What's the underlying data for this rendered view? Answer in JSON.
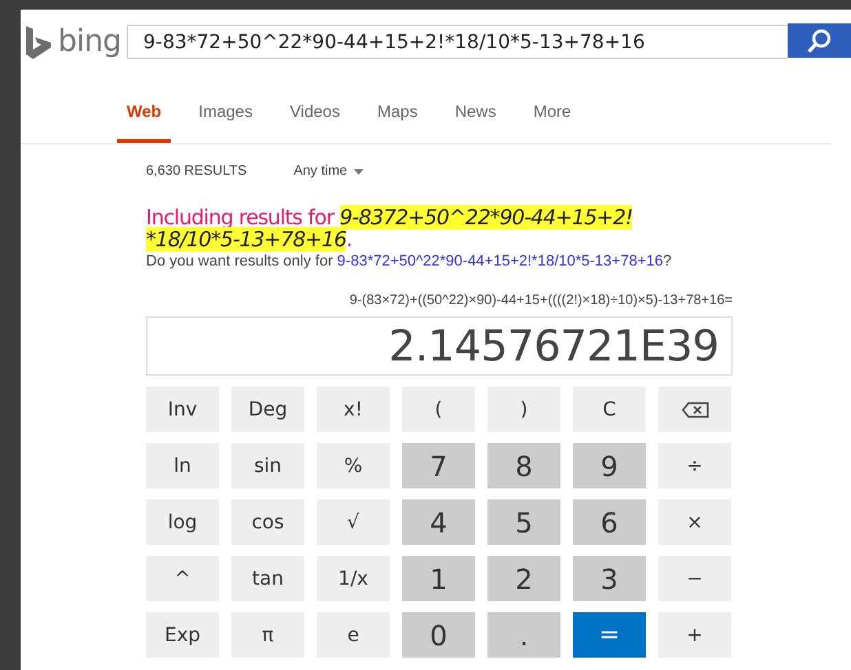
{
  "logo": {
    "text": "bing"
  },
  "search": {
    "value": "9-83*72+50^22*90-44+15+2!*18/10*5-13+78+16"
  },
  "tabs": [
    {
      "label": "Web",
      "selected": true
    },
    {
      "label": "Images",
      "selected": false
    },
    {
      "label": "Videos",
      "selected": false
    },
    {
      "label": "Maps",
      "selected": false
    },
    {
      "label": "News",
      "selected": false
    },
    {
      "label": "More",
      "selected": false
    }
  ],
  "results": {
    "count": "6,630 RESULTS",
    "time_filter": "Any time"
  },
  "spelling": {
    "prefix": "Including results for ",
    "query": "9-8372+50^22*90-44+15+2!*18/10*5-13+78+16",
    "suffix": ".",
    "question_prefix": "Do you want results only for ",
    "original_query": "9-83*72+50^22*90-44+15+2!*18/10*5-13+78+16",
    "question_suffix": "?"
  },
  "calculator": {
    "expression": "9-(83×72)+((50^22)×90)-44+15+((((2!)×18)÷10)×5)-13+78+16=",
    "display": "2.14576721E39",
    "keys": [
      {
        "label": "Inv",
        "kind": "function"
      },
      {
        "label": "Deg",
        "kind": "function"
      },
      {
        "label": "x!",
        "kind": "function"
      },
      {
        "label": "(",
        "kind": "function"
      },
      {
        "label": ")",
        "kind": "function"
      },
      {
        "label": "C",
        "kind": "function"
      },
      {
        "kind": "backspace"
      },
      {
        "label": "ln",
        "kind": "function"
      },
      {
        "label": "sin",
        "kind": "function"
      },
      {
        "label": "%",
        "kind": "function"
      },
      {
        "label": "7",
        "kind": "digit"
      },
      {
        "label": "8",
        "kind": "digit"
      },
      {
        "label": "9",
        "kind": "digit"
      },
      {
        "label": "÷",
        "kind": "function"
      },
      {
        "label": "log",
        "kind": "function"
      },
      {
        "label": "cos",
        "kind": "function"
      },
      {
        "label": "√",
        "kind": "function"
      },
      {
        "label": "4",
        "kind": "digit"
      },
      {
        "label": "5",
        "kind": "digit"
      },
      {
        "label": "6",
        "kind": "digit"
      },
      {
        "label": "×",
        "kind": "function"
      },
      {
        "label": "^",
        "kind": "function"
      },
      {
        "label": "tan",
        "kind": "function"
      },
      {
        "label": "1/x",
        "kind": "function"
      },
      {
        "label": "1",
        "kind": "digit"
      },
      {
        "label": "2",
        "kind": "digit"
      },
      {
        "label": "3",
        "kind": "digit"
      },
      {
        "label": "−",
        "kind": "function"
      },
      {
        "label": "Exp",
        "kind": "function"
      },
      {
        "label": "π",
        "kind": "function"
      },
      {
        "label": "e",
        "kind": "function"
      },
      {
        "label": "0",
        "kind": "digit"
      },
      {
        "label": ".",
        "kind": "digit"
      },
      {
        "label": "=",
        "kind": "equals"
      },
      {
        "label": "+",
        "kind": "function"
      }
    ]
  }
}
